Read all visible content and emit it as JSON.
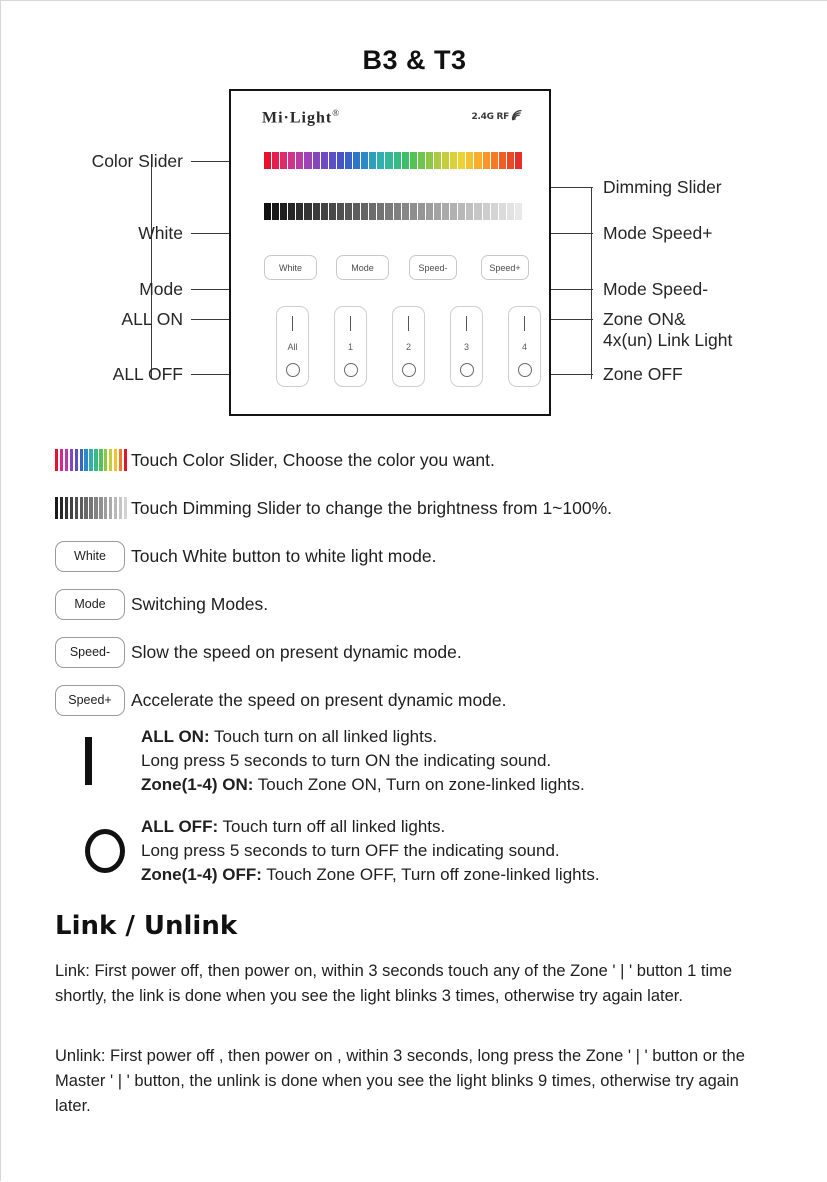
{
  "title": "B3 & T3",
  "device": {
    "brand": "Mi·Light",
    "brand_reg": "®",
    "rf_label": "2.4G RF",
    "rf_icon": "signal-icon",
    "buttons": [
      {
        "label": "White",
        "name": "white-button"
      },
      {
        "label": "Mode",
        "name": "mode-button"
      },
      {
        "label": "Speed-",
        "name": "speed-down-button"
      },
      {
        "label": "Speed+",
        "name": "speed-up-button"
      }
    ],
    "zones": [
      {
        "label": "All",
        "name": "zone-all"
      },
      {
        "label": "1",
        "name": "zone-1"
      },
      {
        "label": "2",
        "name": "zone-2"
      },
      {
        "label": "3",
        "name": "zone-3"
      },
      {
        "label": "4",
        "name": "zone-4"
      }
    ],
    "zone_on_glyph": "|",
    "zone_off_glyph": "○"
  },
  "callouts_left": [
    {
      "label": "Color Slider",
      "name": "callout-color-slider"
    },
    {
      "label": "White",
      "name": "callout-white"
    },
    {
      "label": "Mode",
      "name": "callout-mode"
    },
    {
      "label": "ALL ON",
      "name": "callout-all-on"
    },
    {
      "label": "ALL OFF",
      "name": "callout-all-off"
    }
  ],
  "callouts_right": [
    {
      "label": "Dimming Slider",
      "name": "callout-dimming-slider"
    },
    {
      "label": "Mode Speed+",
      "name": "callout-mode-speed-up"
    },
    {
      "label": "Mode Speed-",
      "name": "callout-mode-speed-down"
    },
    {
      "label_line1": "Zone ON&",
      "label_line2": "4x(un) Link Light",
      "name": "callout-zone-on"
    },
    {
      "label": "Zone OFF",
      "name": "callout-zone-off"
    }
  ],
  "legend": [
    {
      "kind": "color-swatch",
      "name": "legend-color-slider",
      "text": "Touch Color Slider, Choose the color you want."
    },
    {
      "kind": "dim-swatch",
      "name": "legend-dimming-slider",
      "text": "Touch Dimming Slider to change the brightness from 1~100%."
    },
    {
      "kind": "pill",
      "pill": "White",
      "name": "legend-white-button",
      "text": "Touch White button to white light mode."
    },
    {
      "kind": "pill",
      "pill": "Mode",
      "name": "legend-mode-button",
      "text": "Switching Modes."
    },
    {
      "kind": "pill",
      "pill": "Speed-",
      "name": "legend-speed-down-button",
      "text": "Slow the speed on present dynamic mode."
    },
    {
      "kind": "pill",
      "pill": "Speed+",
      "name": "legend-speed-up-button",
      "text": "Accelerate the speed on present dynamic mode."
    }
  ],
  "on_block": {
    "glyph": "power-on-bar-icon",
    "line1_bold": "ALL ON:",
    "line1_rest": " Touch turn on all linked lights.",
    "line2": "Long press 5 seconds to turn ON the indicating sound.",
    "line3_bold": "Zone(1-4) ON:",
    "line3_rest": " Touch Zone ON, Turn on zone-linked lights."
  },
  "off_block": {
    "glyph": "power-off-circle-icon",
    "line1_bold": "ALL OFF:",
    "line1_rest": " Touch turn off all linked lights.",
    "line2": "Long press 5 seconds to turn OFF the indicating sound.",
    "line3_bold": "Zone(1-4) OFF:",
    "line3_rest": " Touch Zone OFF, Turn off zone-linked lights."
  },
  "link_section": {
    "heading": "Link / Unlink",
    "link_label": "Link:",
    "link_text": " First power off, then power on, within 3 seconds touch any of the Zone ' | ' button 1 time shortly, the link is done when you see the light blinks 3 times, otherwise try again later.",
    "unlink_label": "Unlink:",
    "unlink_text": " First power off , then power on , within 3 seconds, long press the Zone ' | ' button or the Master ' | ' button, the unlink is done when you see the light blinks 9 times, otherwise try again later."
  },
  "colors": {
    "panel_border": "#141414",
    "leader_line": "#3b3b3b",
    "text": "#1f1f1f",
    "color_slider": [
      "#e8112d",
      "#e51f4b",
      "#e02a6b",
      "#d0338c",
      "#b93ba6",
      "#9f42b8",
      "#8546bd",
      "#6d4ac0",
      "#5a4fc4",
      "#4755c6",
      "#3a63c8",
      "#2f76c9",
      "#2b8ac6",
      "#2e9dbe",
      "#31aeb0",
      "#34b79a",
      "#37bb83",
      "#3fbe6a",
      "#54c157",
      "#6fc44c",
      "#8cc746",
      "#a9ca41",
      "#c6cd3c",
      "#dccf37",
      "#ecd233",
      "#f3c22f",
      "#f6ae2c",
      "#f69528",
      "#f47a25",
      "#ef5f23",
      "#e94a26",
      "#e42f2b"
    ],
    "dim_slider_from": "#111111",
    "dim_slider_to": "#e9e9e9",
    "legend_color_bars": [
      "#e8112d",
      "#d8248b",
      "#b93ba6",
      "#8546bd",
      "#5a4fc4",
      "#3a63c8",
      "#2b8ac6",
      "#31aeb0",
      "#37bb83",
      "#54c157",
      "#8cc746",
      "#c6cd3c",
      "#f3c22f",
      "#f47a25",
      "#e8112d"
    ],
    "legend_dim_from": "#1a1a1a",
    "legend_dim_to": "#d2d2d2"
  }
}
